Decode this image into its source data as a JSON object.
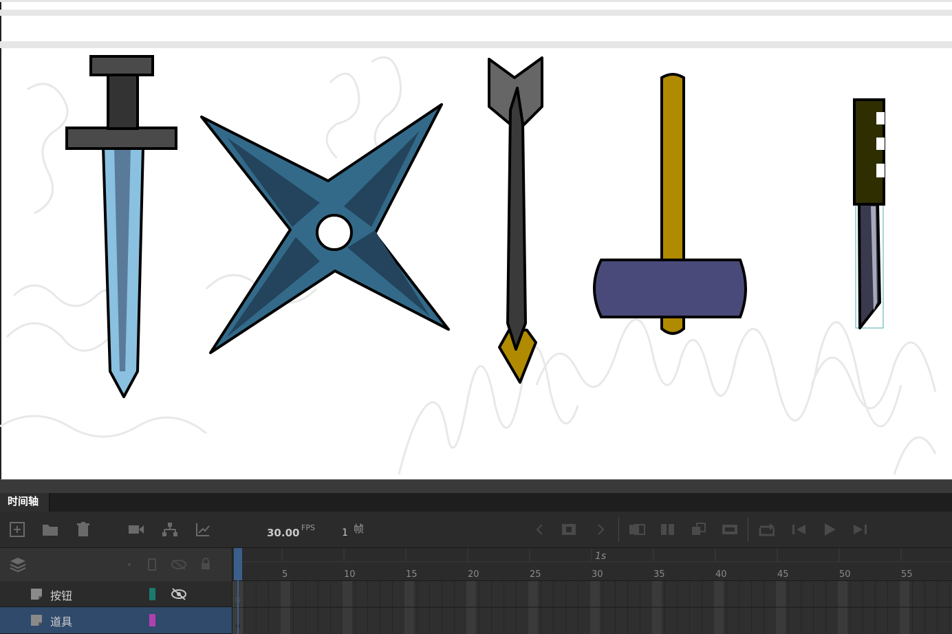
{
  "panel": {
    "tab_label": "时间轴",
    "fps_value": "30.00",
    "fps_unit": "FPS",
    "frame_value": "1",
    "frame_unit": "帧",
    "second_marker": "1s",
    "ruler_numbers": [
      "5",
      "10",
      "15",
      "20",
      "25",
      "30",
      "35",
      "40",
      "45",
      "50",
      "55"
    ]
  },
  "layers": [
    {
      "name": "按钮",
      "color": "#1a7a6e",
      "hidden": true,
      "selected": false
    },
    {
      "name": "道具",
      "color": "#b040b0",
      "hidden": false,
      "selected": true
    }
  ],
  "stage": {
    "items": [
      "sword-icon",
      "shuriken-icon",
      "arrow-icon",
      "hammer-icon",
      "knife-icon"
    ]
  },
  "colors": {
    "accent": "#3a5f8a",
    "selected_row": "#2f4a6a",
    "shuriken": "#336a8a",
    "hammer_head": "#4a4a7a",
    "gold": "#b08a00"
  }
}
